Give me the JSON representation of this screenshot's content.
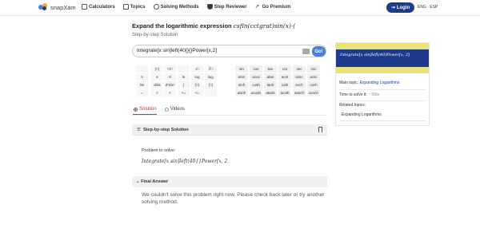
{
  "header": {
    "logo_text": "snapXam",
    "nav": [
      {
        "label": "Calculators",
        "icon": "calculator-icon"
      },
      {
        "label": "Topics",
        "icon": "book-icon"
      },
      {
        "label": "Solving Methods",
        "icon": "gears-icon"
      },
      {
        "label": "Step Reviewer",
        "icon": "shield-icon"
      },
      {
        "label": "Go Premium",
        "icon": "rocket-icon"
      }
    ],
    "login_label": "Login",
    "lang_label": "ENG · ESP",
    "brand_colors": {
      "primary": "#1e3a8a",
      "accent": "#f5a623",
      "logo_blue": "#4a7fd6"
    }
  },
  "problem": {
    "title_prefix": "Expand the logarithmic expression",
    "title_expr": "csfln(cctgrat)sin(x)·(",
    "subtitle": "Step-by-step Solution",
    "input_value": "Integrate[x sin]left(40{}{}Power[x,2]",
    "go_label": "Go!"
  },
  "keypad": {
    "math_keys": [
      [
        "",
        "(□)",
        "□/□",
        "·",
        "√□",
        "∛□"
      ],
      [
        "π",
        "e",
        "π",
        "ln",
        "log",
        "log₂"
      ],
      [
        "lim",
        "d/dx",
        "dⁿ/dxⁿ",
        "∫",
        "(□)",
        "(□)"
      ],
      [
        "=",
        ">",
        "<",
        ">=",
        "<=",
        ""
      ]
    ],
    "trig_keys": [
      [
        "sin",
        "cos",
        "tan",
        "cot",
        "sec",
        "csc"
      ],
      [
        "asin",
        "acos",
        "atan",
        "acot",
        "asec",
        "acsc"
      ],
      [
        "sinh",
        "cosh",
        "tanh",
        "coth",
        "sech",
        "csch"
      ],
      [
        "asinh",
        "acosh",
        "atanh",
        "acoth",
        "asech",
        "acsch"
      ]
    ]
  },
  "tabs": {
    "solution": "Solution",
    "videos": "Videos"
  },
  "steps": {
    "header": "Step-by-step Solution",
    "problem_label": "Problem to solve:",
    "problem_expr": "Integrate[x sin]left(40{}Power[x, 2"
  },
  "final_answer": {
    "header": "Final Answer",
    "message": "We couldn't solve this problem right now. Please check back later or try another solving method."
  },
  "card": {
    "banner_expr": "Integrate[x sin]left(40)Power[x, 2]",
    "main_topic_label": "Main topic:",
    "main_topic_value": "Expanding Logarithms",
    "time_label": "Time to solve it:",
    "time_value": "~ 00ts",
    "related_label": "Related topics:",
    "related_item": "Expanding Logarithms"
  }
}
